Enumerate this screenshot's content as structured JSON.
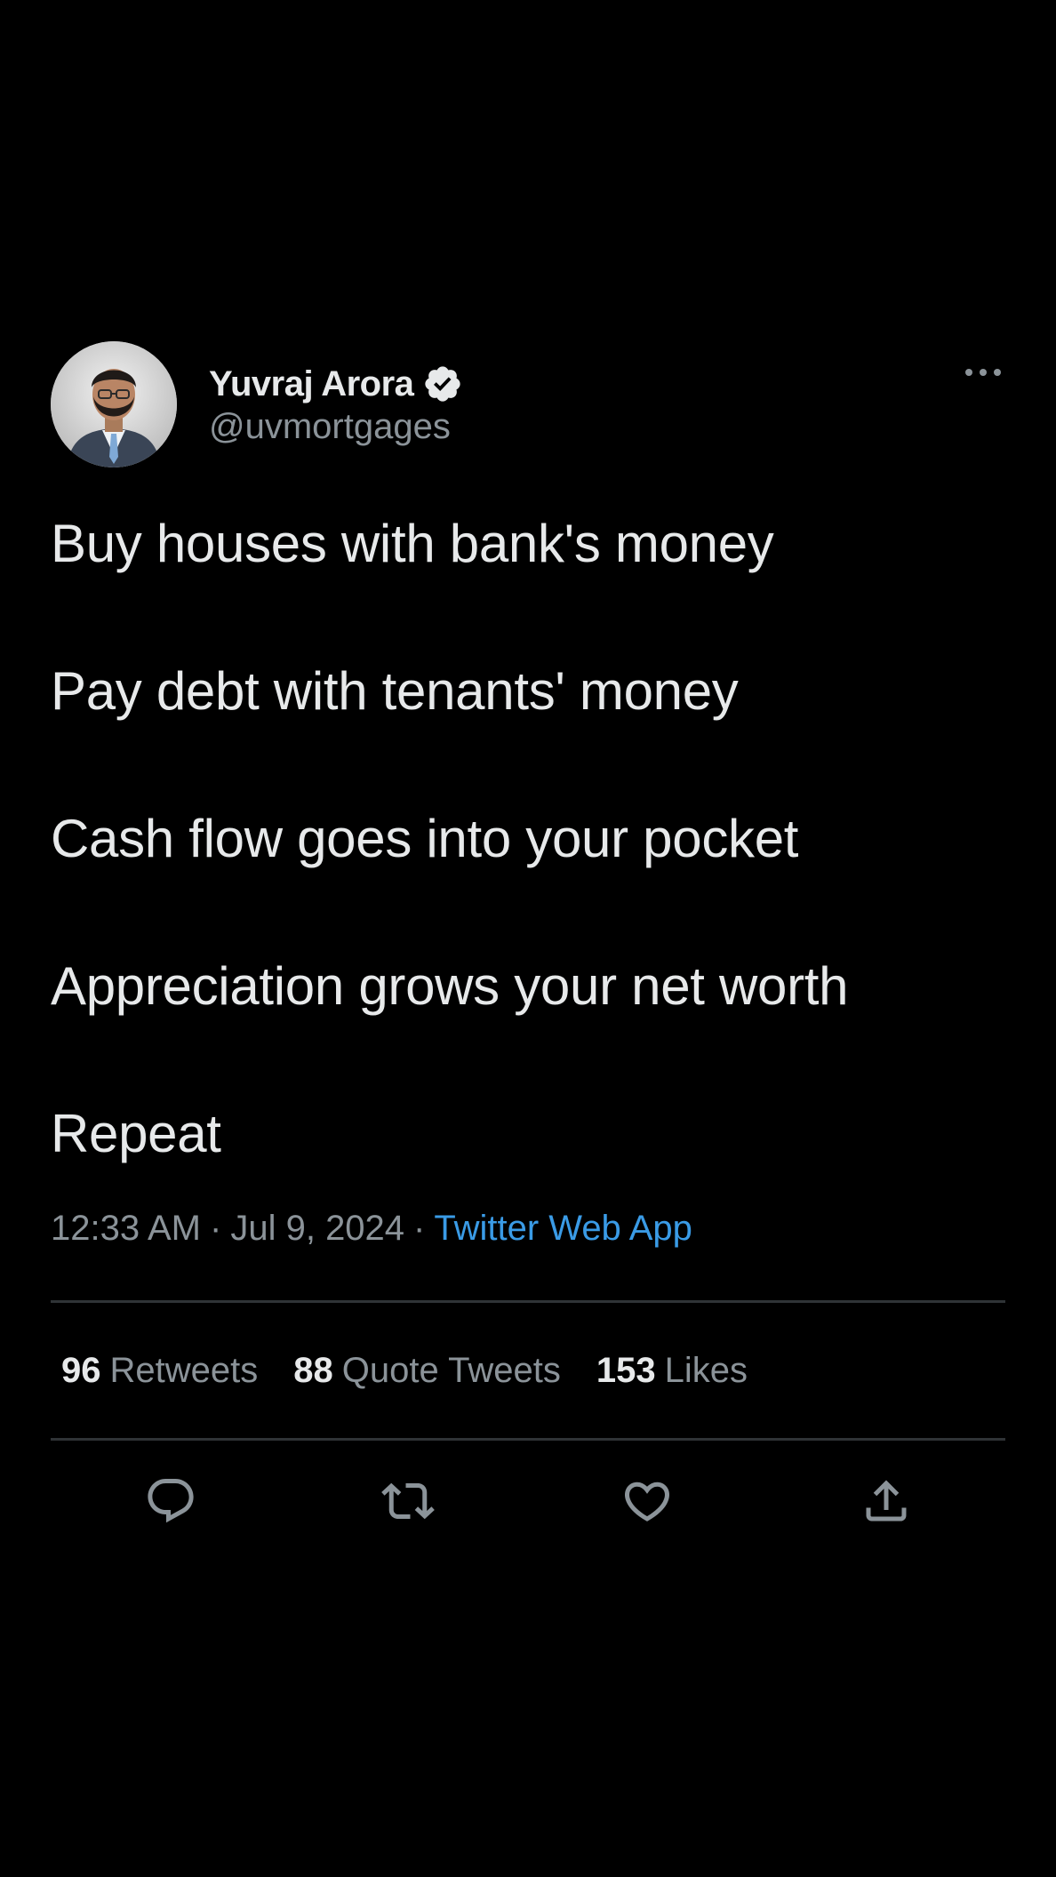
{
  "user": {
    "display_name": "Yuvraj Arora",
    "handle": "@uvmortgages",
    "verified": true
  },
  "icons": {
    "avatar": "profile-photo",
    "verified": "verified-badge-icon",
    "more": "more-options-icon",
    "reply": "reply-icon",
    "retweet": "retweet-icon",
    "like": "like-icon",
    "share": "share-icon"
  },
  "tweet": {
    "lines": [
      "Buy houses with bank's money",
      "Pay debt with tenants' money",
      "Cash flow goes into your pocket",
      "Appreciation grows your net worth",
      "Repeat"
    ],
    "time": "12:33 AM",
    "date": "Jul 9, 2024",
    "separator": "·",
    "source": "Twitter Web App"
  },
  "stats": {
    "retweets": {
      "count": "96",
      "label": "Retweets"
    },
    "quotes": {
      "count": "88",
      "label": "Quote Tweets"
    },
    "likes": {
      "count": "153",
      "label": "Likes"
    }
  },
  "colors": {
    "background": "#000000",
    "text": "#e7e9ea",
    "secondary_text": "#8b9399",
    "link": "#3a9be6",
    "divider": "#2f3336"
  }
}
